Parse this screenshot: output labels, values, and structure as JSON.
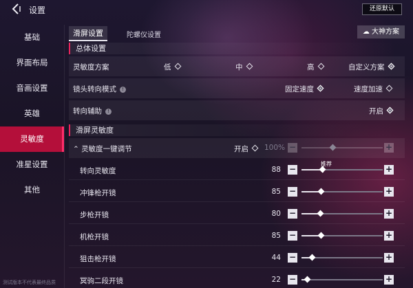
{
  "topbar": {
    "title": "设置",
    "restore_label": "还原默认"
  },
  "sidebar": {
    "items": [
      {
        "label": "基础",
        "active": false
      },
      {
        "label": "界面布局",
        "active": false
      },
      {
        "label": "音画设置",
        "active": false
      },
      {
        "label": "英雄",
        "active": false
      },
      {
        "label": "灵敏度",
        "active": true
      },
      {
        "label": "准星设置",
        "active": false
      },
      {
        "label": "其他",
        "active": false
      }
    ],
    "hint": "测试版本不代表最终品质"
  },
  "tabs": {
    "active": "滑屏设置",
    "inactive": "陀螺仪设置",
    "scheme_button": "大神方案"
  },
  "overall": {
    "title": "总体设置",
    "sensitivity_scheme": {
      "label": "灵敏度方案",
      "options": [
        {
          "label": "低",
          "selected": false
        },
        {
          "label": "中",
          "selected": false
        },
        {
          "label": "高",
          "selected": false
        },
        {
          "label": "自定义方案",
          "selected": true
        }
      ]
    },
    "camera_mode": {
      "label": "镜头转向模式",
      "options": [
        {
          "label": "固定速度",
          "selected": true
        },
        {
          "label": "速度加速",
          "selected": false
        }
      ]
    },
    "turn_assist": {
      "label": "转向辅助",
      "option": "开启",
      "selected": true
    }
  },
  "swipe": {
    "title": "滑屏灵敏度",
    "one_key": {
      "label": "灵敏度一键调节",
      "option": "开启",
      "selected": false,
      "value": "100%",
      "level": 0.38
    },
    "rows": [
      {
        "label": "转向灵敏度",
        "value": "88",
        "level": 0.25,
        "recommend": "推荐"
      },
      {
        "label": "冲锋枪开镜",
        "value": "85",
        "level": 0.24
      },
      {
        "label": "步枪开镜",
        "value": "80",
        "level": 0.23
      },
      {
        "label": "机枪开镜",
        "value": "85",
        "level": 0.24
      },
      {
        "label": "狙击枪开镜",
        "value": "44",
        "level": 0.13
      },
      {
        "label": "冥驹二段开镜",
        "value": "22",
        "level": 0.07
      }
    ]
  },
  "colors": {
    "accent": "#b40f3a",
    "accent_bar": "#e8245c"
  }
}
